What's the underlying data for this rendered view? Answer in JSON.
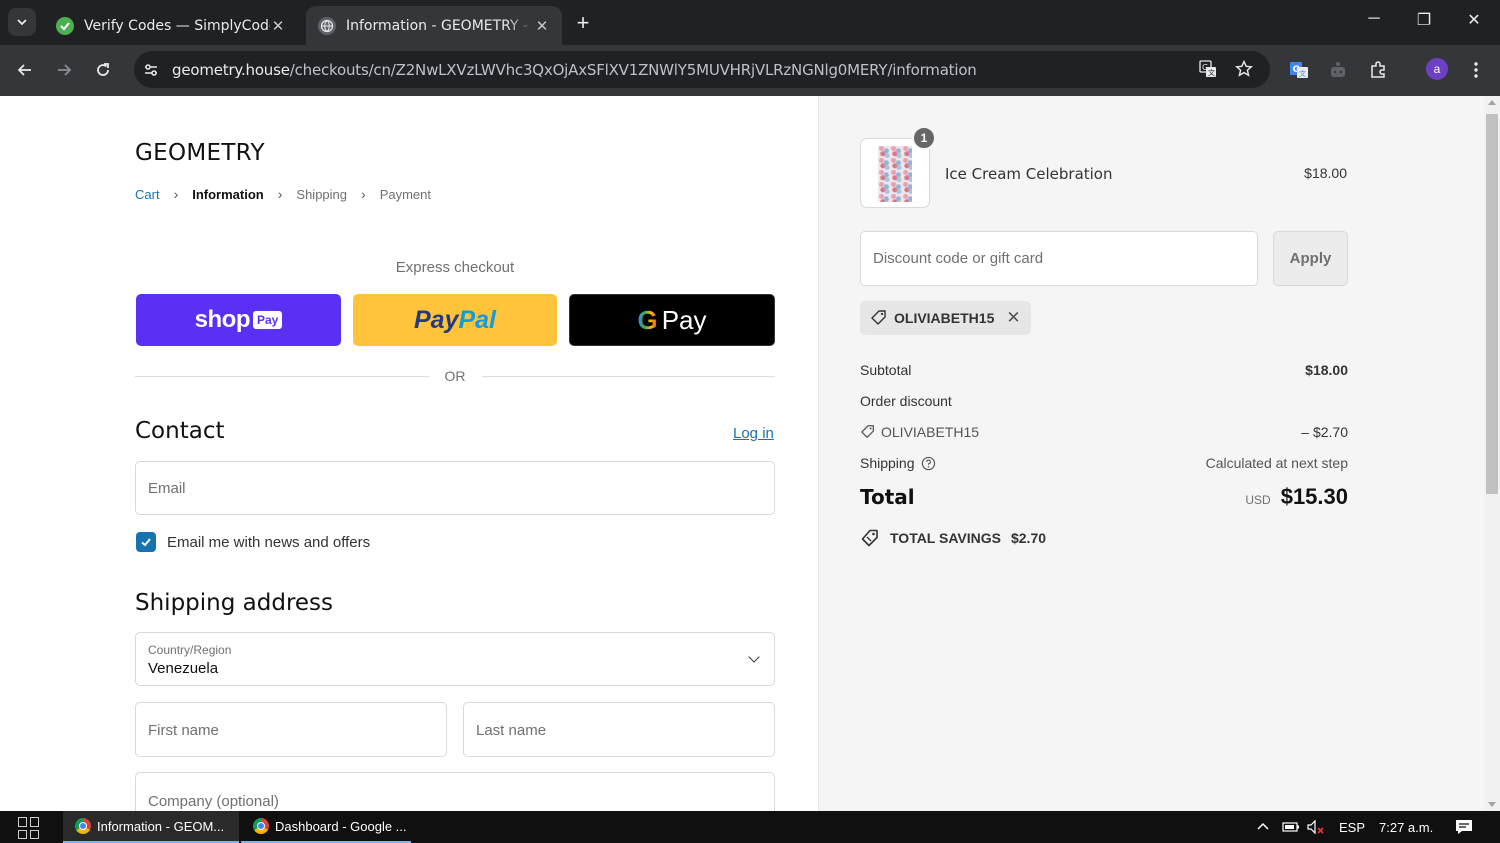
{
  "browser": {
    "tabs": [
      {
        "title": "Verify Codes — SimplyCodes",
        "active": false
      },
      {
        "title": "Information - GEOMETRY - Checkout",
        "active": true
      }
    ],
    "url_host": "geometry.house",
    "url_path": "/checkouts/cn/Z2NwLXVzLWVhc3QxOjAxSFlXV1ZNWlY5MUVHRjVLRzNGNlg0MERY/information"
  },
  "checkout": {
    "logo": "GEOMETRY",
    "breadcrumb": [
      "Cart",
      "Information",
      "Shipping",
      "Payment"
    ],
    "express_label": "Express checkout",
    "shoppay": {
      "shop": "shop",
      "pay": "Pay"
    },
    "paypal": {
      "p1": "Pay",
      "p2": "Pal"
    },
    "gpay": {
      "g": "G",
      "pay": "Pay"
    },
    "or_text": "OR",
    "contact_heading": "Contact",
    "login_link": "Log in",
    "email_placeholder": "Email",
    "newsletter_label": "Email me with news and offers",
    "newsletter_checked": true,
    "shipping_heading": "Shipping address",
    "country_label": "Country/Region",
    "country_value": "Venezuela",
    "first_name_placeholder": "First name",
    "last_name_placeholder": "Last name",
    "company_placeholder": "Company (optional)"
  },
  "summary": {
    "product": {
      "name": "Ice Cream Celebration",
      "price": "$18.00",
      "quantity": "1"
    },
    "discount_placeholder": "Discount code or gift card",
    "apply_label": "Apply",
    "applied_code": "OLIVIABETH15",
    "subtotal_label": "Subtotal",
    "subtotal_value": "$18.00",
    "order_discount_label": "Order discount",
    "discount_code": "OLIVIABETH15",
    "discount_value": "– $2.70",
    "shipping_label": "Shipping",
    "shipping_value": "Calculated at next step",
    "total_label": "Total",
    "total_currency": "USD",
    "total_value": "$15.30",
    "savings_label": "TOTAL SAVINGS",
    "savings_value": "$2.70"
  },
  "taskbar": {
    "items": [
      "Information - GEOM...",
      "Dashboard - Google ..."
    ],
    "language": "ESP",
    "time": "7:27 a.m."
  },
  "colors": {
    "accent": "#1773b0",
    "shoppay": "#5a31f4",
    "paypal": "#ffc439"
  }
}
